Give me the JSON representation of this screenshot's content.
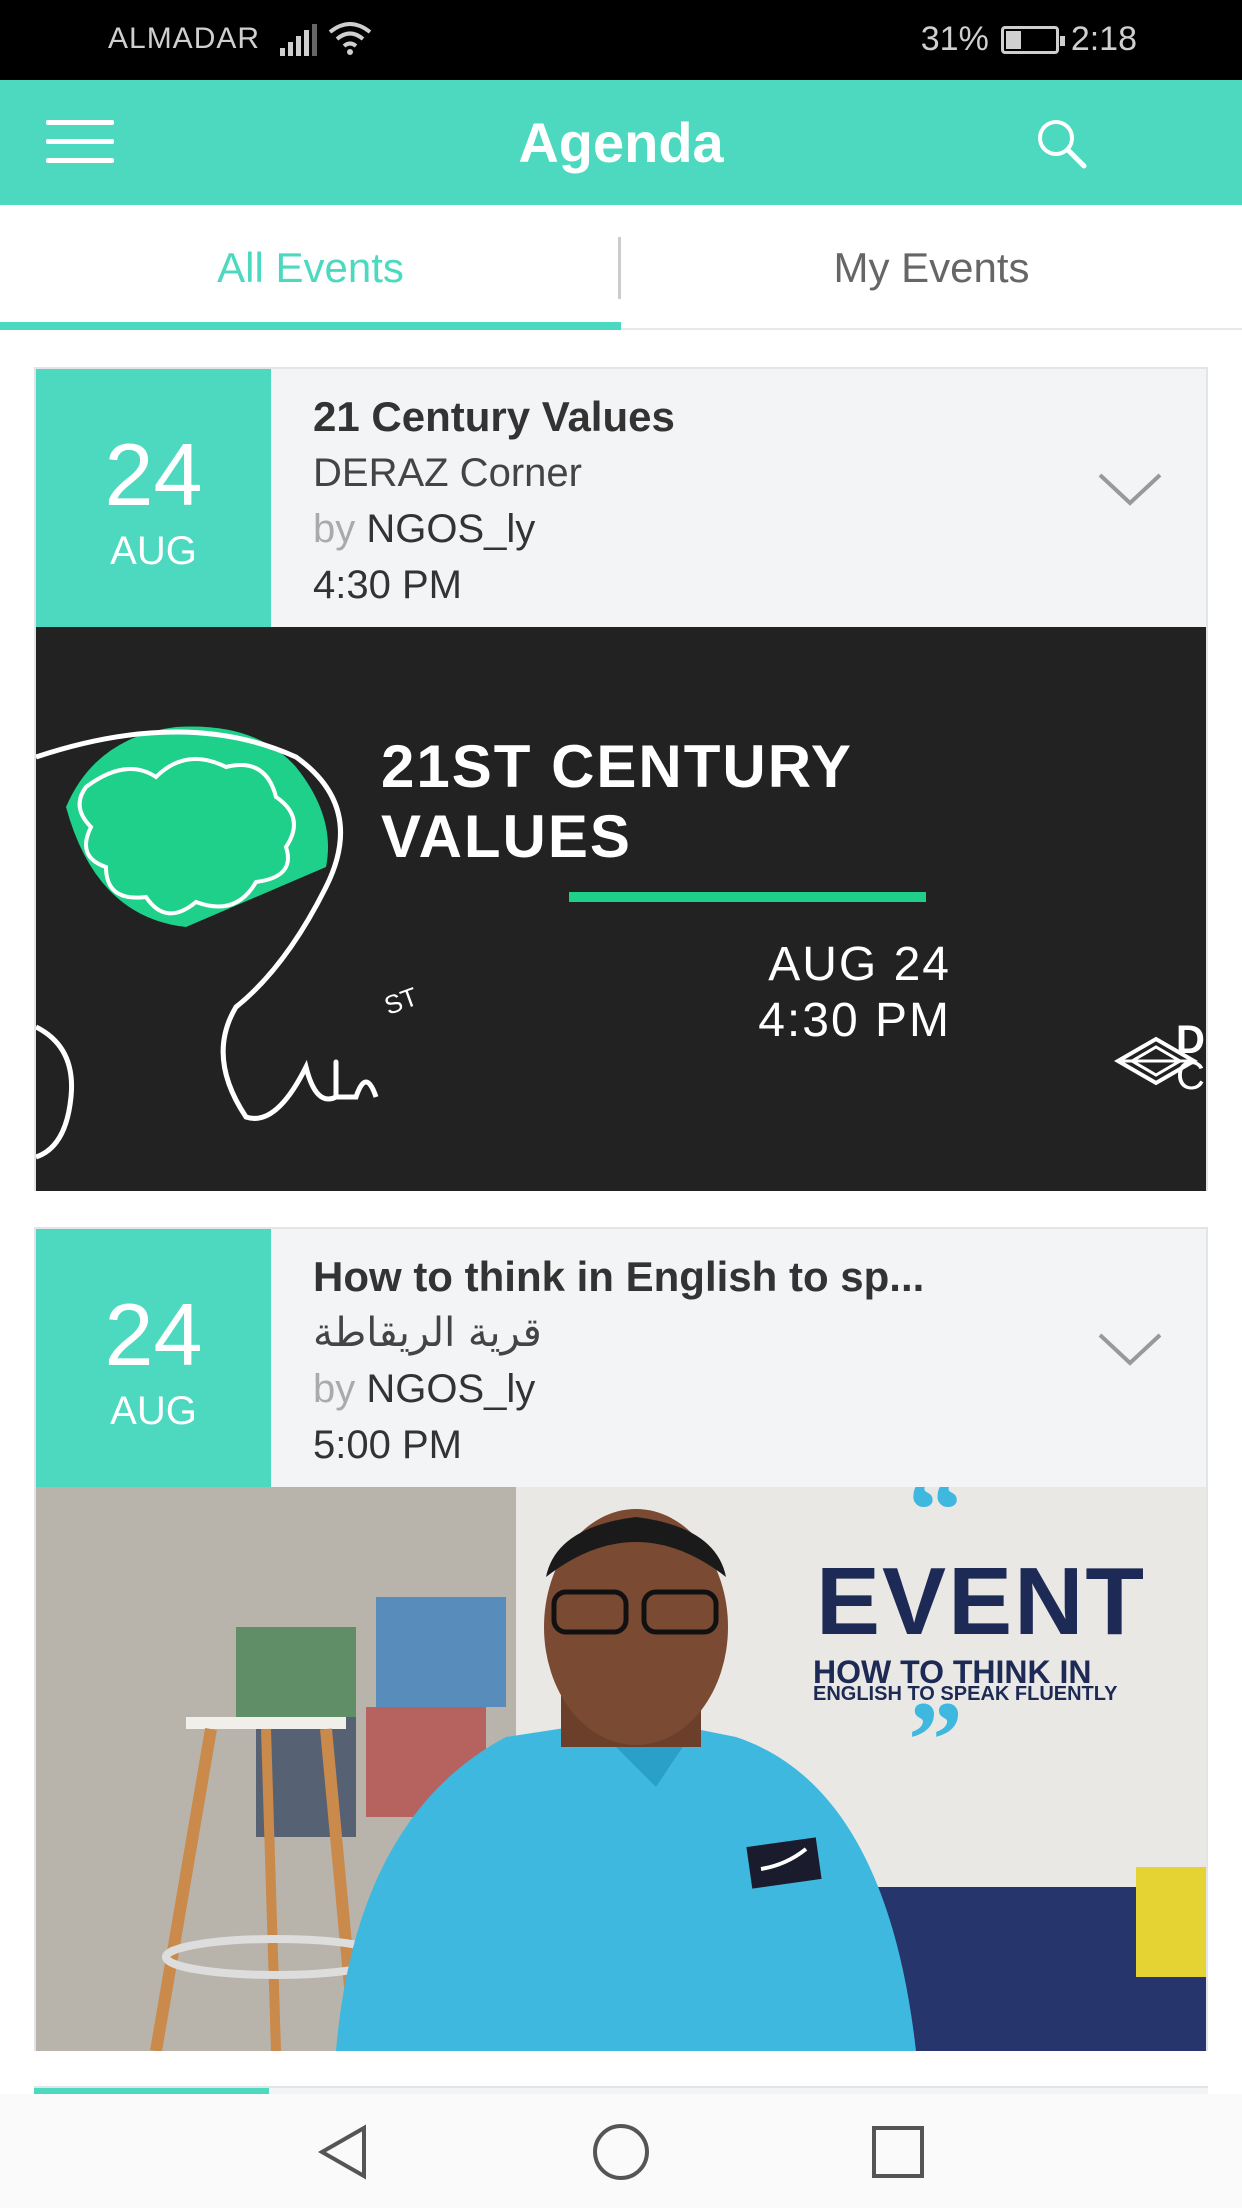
{
  "status_bar": {
    "carrier": "ALMADAR",
    "battery_percent": "31%",
    "battery_level": 0.31,
    "time": "2:18"
  },
  "app_bar": {
    "title": "Agenda",
    "menu_icon": "hamburger-menu-icon",
    "search_icon": "search-icon"
  },
  "tabs": [
    {
      "label": "All Events",
      "active": true
    },
    {
      "label": "My Events",
      "active": false
    }
  ],
  "colors": {
    "accent": "#4dd9bf",
    "poster_green": "#1ed08a",
    "card_bg": "#f3f4f6"
  },
  "events": [
    {
      "day": "24",
      "month": "AUG",
      "title": "21 Century Values",
      "venue": "DERAZ Corner",
      "by_label": "by",
      "organizer": "NGOS_ly",
      "time": "4:30 PM",
      "poster": {
        "title_line1": "21ST CENTURY",
        "title_line2": "VALUES",
        "date": "AUG 24",
        "time": "4:30 PM",
        "brand_line1": "D",
        "brand_line2": "C",
        "doodle": "ST"
      }
    },
    {
      "day": "24",
      "month": "AUG",
      "title": "How to think in English to sp...",
      "venue": "قرية الريقاطة",
      "by_label": "by",
      "organizer": "NGOS_ly",
      "time": "5:00 PM",
      "poster": {
        "heading": "EVENT",
        "sub1": "HOW TO THINK IN",
        "sub2": "ENGLISH TO SPEAK FLUENTLY"
      }
    }
  ],
  "nav_bar": {
    "back_icon": "back-triangle-icon",
    "home_icon": "home-circle-icon",
    "recents_icon": "recents-square-icon"
  }
}
